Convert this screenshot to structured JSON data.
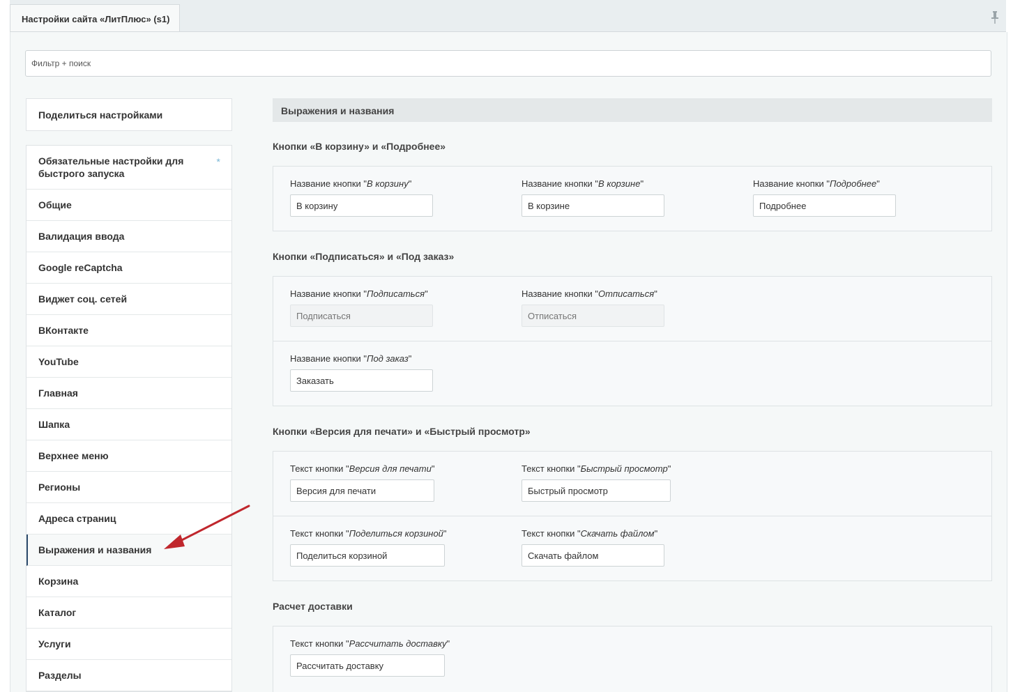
{
  "tab": {
    "title": "Настройки сайта «ЛитПлюс» (s1)"
  },
  "search": {
    "placeholder": "Фильтр + поиск"
  },
  "sidebar": {
    "share_label": "Поделиться настройками",
    "items": [
      {
        "label": "Обязательные настройки для быстрого запуска",
        "star": "*"
      },
      {
        "label": "Общие"
      },
      {
        "label": "Валидация ввода"
      },
      {
        "label": "Google reCaptcha"
      },
      {
        "label": "Виджет соц. сетей"
      },
      {
        "label": "ВКонтакте"
      },
      {
        "label": "YouTube"
      },
      {
        "label": "Главная"
      },
      {
        "label": "Шапка"
      },
      {
        "label": "Верхнее меню"
      },
      {
        "label": "Регионы"
      },
      {
        "label": "Адреса страниц"
      },
      {
        "label": "Выражения и названия",
        "active": true
      },
      {
        "label": "Корзина"
      },
      {
        "label": "Каталог"
      },
      {
        "label": "Услуги"
      },
      {
        "label": "Разделы"
      }
    ]
  },
  "main": {
    "section_title": "Выражения и названия",
    "groups": [
      {
        "title": "Кнопки «В корзину» и «Подробнее»",
        "fields": [
          {
            "prefix": "Название кнопки \"",
            "name": "В корзину",
            "suffix": "\"",
            "value": "В корзину"
          },
          {
            "prefix": "Название кнопки \"",
            "name": "В корзине",
            "suffix": "\"",
            "value": "В корзине"
          },
          {
            "prefix": "Название кнопки \"",
            "name": "Подробнее",
            "suffix": "\"",
            "value": "Подробнее"
          }
        ]
      },
      {
        "title": "Кнопки «Подписаться» и «Под заказ»",
        "fields": [
          {
            "prefix": "Название кнопки \"",
            "name": "Подписаться",
            "suffix": "\"",
            "placeholder": "Подписаться"
          },
          {
            "prefix": "Название кнопки \"",
            "name": "Отписаться",
            "suffix": "\"",
            "placeholder": "Отписаться"
          },
          {
            "prefix": "Название кнопки \"",
            "name": "Под заказ",
            "suffix": "\"",
            "value": "Заказать"
          }
        ]
      },
      {
        "title": "Кнопки «Версия для печати» и «Быстрый просмотр»",
        "fields": [
          {
            "prefix": "Текст кнопки \"",
            "name": "Версия для печати",
            "suffix": "\"",
            "value": "Версия для печати"
          },
          {
            "prefix": "Текст кнопки \"",
            "name": "Быстрый просмотр",
            "suffix": "\"",
            "value": "Быстрый просмотр"
          },
          {
            "prefix": "Текст кнопки \"",
            "name": "Поделиться корзиной",
            "suffix": "\"",
            "value": "Поделиться корзиной"
          },
          {
            "prefix": "Текст кнопки \"",
            "name": "Скачать файлом",
            "suffix": "\"",
            "value": "Скачать файлом"
          }
        ]
      },
      {
        "title": "Расчет доставки",
        "fields": [
          {
            "prefix": "Текст кнопки \"",
            "name": "Рассчитать доставку",
            "suffix": "\"",
            "value": "Рассчитать доставку"
          }
        ]
      }
    ]
  },
  "colors": {
    "arrow": "#c0272d",
    "active_border": "#2d4b6c",
    "star": "#7ab7d6"
  }
}
